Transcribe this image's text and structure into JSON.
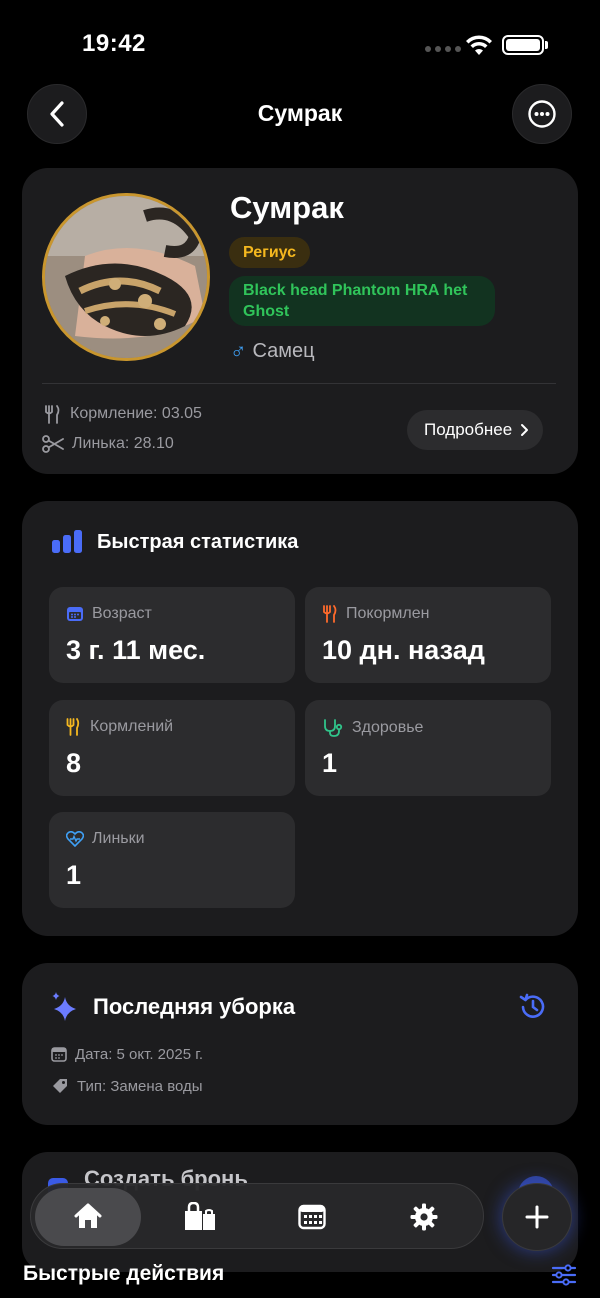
{
  "status_bar": {
    "time": "19:42"
  },
  "nav": {
    "title": "Сумрак"
  },
  "profile": {
    "name": "Сумрак",
    "species": "Региус",
    "morph": "Black head Phantom HRA het Ghost",
    "sex_symbol": "♂",
    "sex": "Самец",
    "feeding": "Кормление: 03.05",
    "molt": "Линька: 28.10",
    "details_label": "Подробнее"
  },
  "stats": {
    "title": "Быстрая статистика",
    "tiles": [
      {
        "icon": "calendar-icon",
        "label": "Возраст",
        "value": "3 г. 11 мес."
      },
      {
        "icon": "fork-knife-icon",
        "label": "Покормлен",
        "value": "10 дн. назад"
      },
      {
        "icon": "fork-knife-icon",
        "label": "Кормлений",
        "value": "8"
      },
      {
        "icon": "stethoscope-icon",
        "label": "Здоровье",
        "value": "1"
      },
      {
        "icon": "heart-icon",
        "label": "Линьки",
        "value": "1"
      }
    ]
  },
  "cleaning": {
    "title": "Последняя уборка",
    "date": "Дата: 5 окт. 2025 г.",
    "type": "Тип: Замена воды"
  },
  "peek_card": {
    "title": "Создать бронь"
  },
  "tabbar": {
    "tabs": [
      "home-icon",
      "bag-icon",
      "calendar-icon",
      "gear-icon"
    ],
    "active": 0
  },
  "quick_actions": {
    "title": "Быстрые действия"
  },
  "colors": {
    "accent": "#3a5ae6",
    "species_badge": "#f5b81f",
    "morph_badge": "#30c45a",
    "sex": "#3fa0f5"
  }
}
